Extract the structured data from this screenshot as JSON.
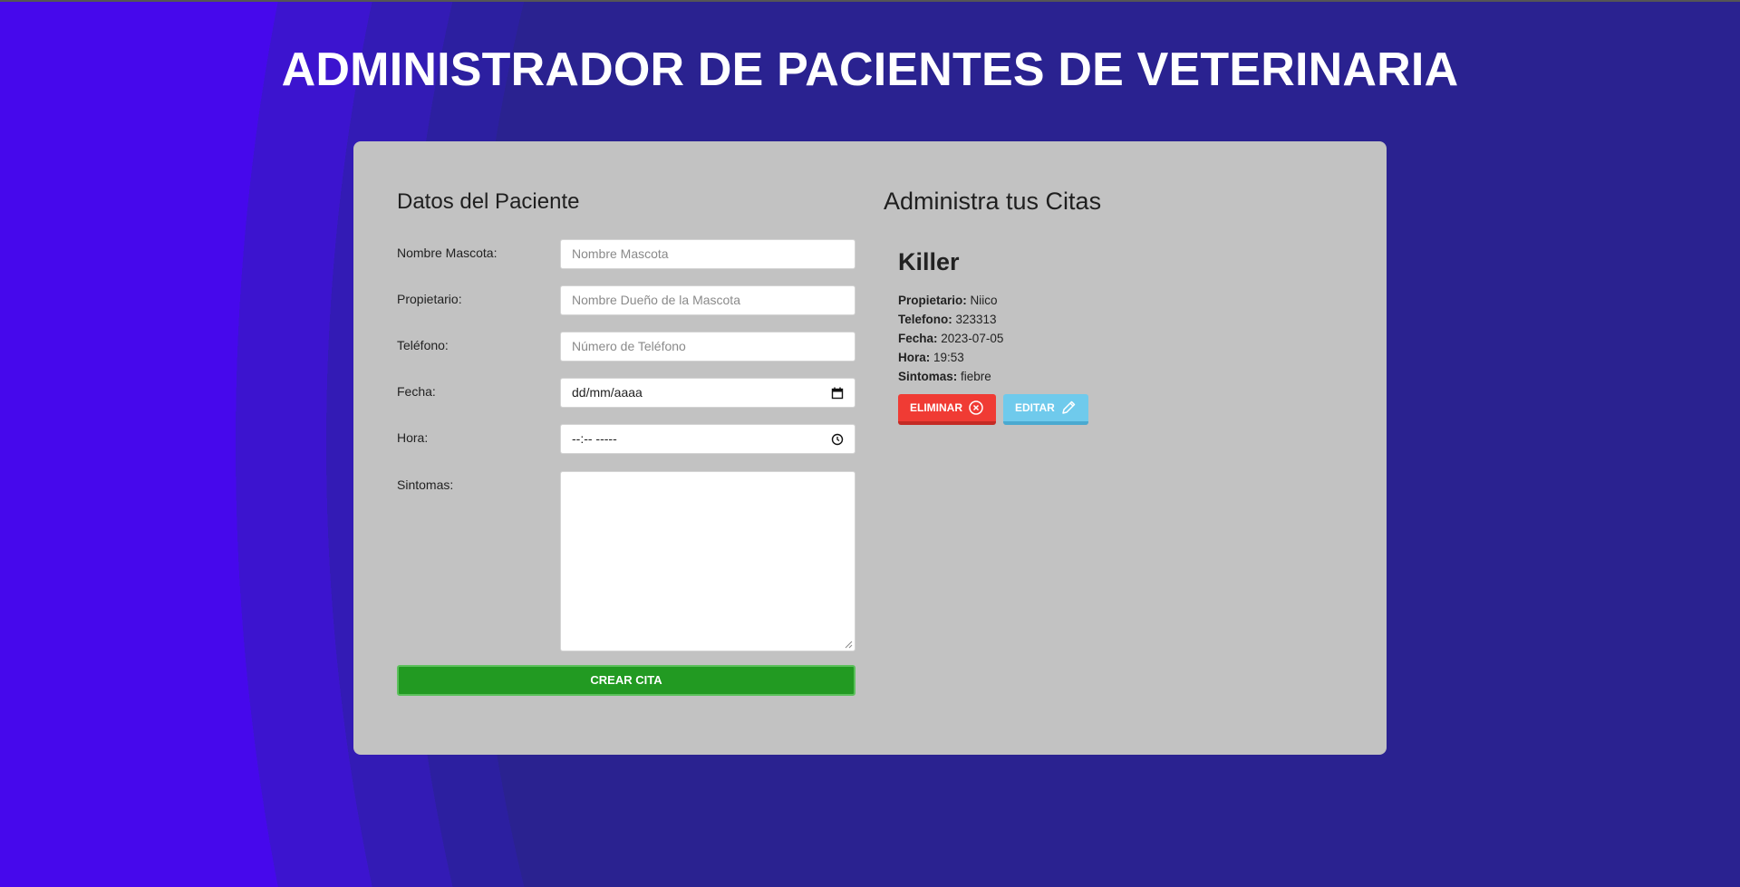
{
  "header": {
    "title": "ADMINISTRADOR DE PACIENTES DE VETERINARIA"
  },
  "form": {
    "title": "Datos del Paciente",
    "fields": [
      {
        "label": "Nombre Mascota:",
        "placeholder": "Nombre Mascota"
      },
      {
        "label": "Propietario:",
        "placeholder": "Nombre Dueño de la Mascota"
      },
      {
        "label": "Teléfono:",
        "placeholder": "Número de Teléfono"
      },
      {
        "label": "Fecha:",
        "value": "dd/mm/aaaa"
      },
      {
        "label": "Hora:",
        "value": "--:-- -----"
      },
      {
        "label": "Sintomas:",
        "value": ""
      }
    ],
    "submit_label": "CREAR CITA"
  },
  "appointments": {
    "title": "Administra tus Citas",
    "items": [
      {
        "name": "Killer",
        "owner_label": "Propietario:",
        "owner": "Niico",
        "phone_label": "Telefono:",
        "phone": "323313",
        "date_label": "Fecha:",
        "date": "2023-07-05",
        "time_label": "Hora:",
        "time": "19:53",
        "symptoms_label": "Sintomas:",
        "symptoms": "fiebre",
        "delete_label": "ELIMINAR",
        "edit_label": "EDITAR"
      }
    ]
  },
  "colors": {
    "background": "#2a2290",
    "card": "#c2c2c2",
    "submit": "#229a22",
    "delete": "#f03b34",
    "edit": "#6fcaec"
  },
  "icons": {
    "delete": "x-circle-icon",
    "edit": "pencil-icon",
    "date": "calendar-icon",
    "time": "clock-icon"
  }
}
